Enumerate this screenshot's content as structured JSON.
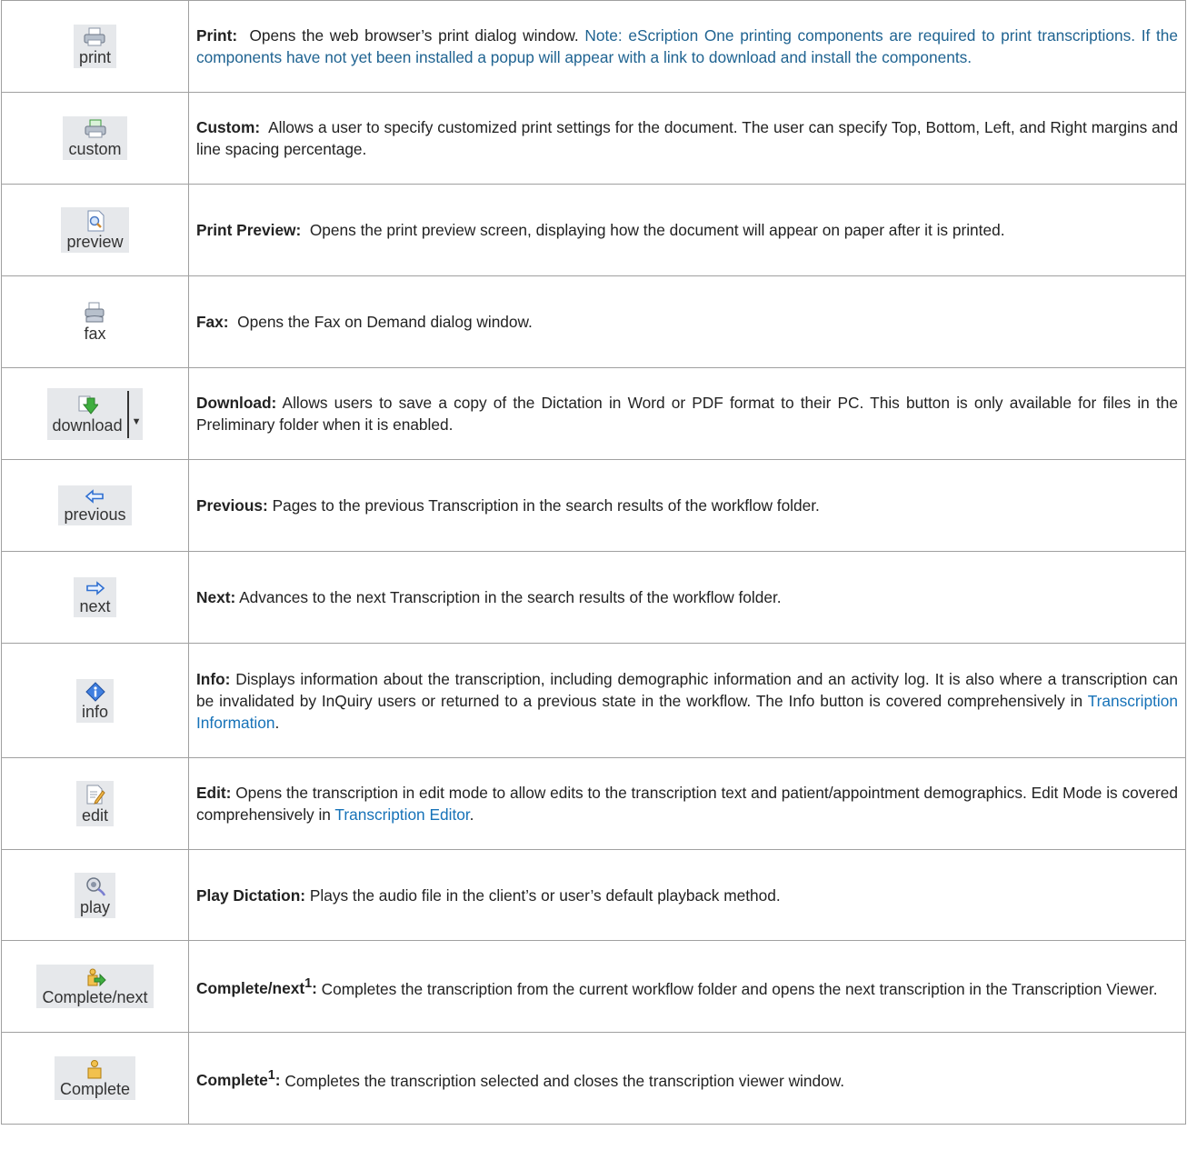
{
  "rows": [
    {
      "icon": "printer-icon",
      "btn": "print",
      "label": "Print:",
      "text": "Opens the web browser’s print dialog window.",
      "note": "Note: eScription One printing components are required to print transcriptions. If the components have not yet been installed a popup will appear with a link to download and install the components."
    },
    {
      "icon": "custom-printer-icon",
      "btn": "custom",
      "label": "Custom:",
      "text": "Allows a user to specify customized print settings for the document. The user can specify Top, Bottom, Left, and Right margins and line spacing percentage."
    },
    {
      "icon": "preview-icon",
      "btn": "preview",
      "label": "Print Preview:",
      "text": "Opens the print preview screen, displaying how the document will appear on paper after it is printed."
    },
    {
      "icon": "fax-icon",
      "btn": "fax",
      "label": "Fax:",
      "text": "Opens the Fax on Demand dialog window."
    },
    {
      "icon": "download-icon",
      "btn": "download",
      "label": "Download:",
      "text": "Allows users to save a copy of the Dictation in Word or PDF format to their PC. This button is only available for files in the Preliminary folder when it is enabled."
    },
    {
      "icon": "arrow-left-icon",
      "btn": "previous",
      "label": "Previous:",
      "text": "Pages to the previous Transcription in the search results of the workflow folder."
    },
    {
      "icon": "arrow-right-icon",
      "btn": "next",
      "label": "Next:",
      "text": "Advances to the next Transcription in the search results of the workflow folder."
    },
    {
      "icon": "info-icon",
      "btn": "info",
      "label": "Info:",
      "text": "Displays information about the transcription, including demographic information and an activity log. It is also where a transcription can be invalidated by InQuiry users or returned to a previous state in the workflow. The Info button is covered comprehensively in",
      "link": "Transcription Information",
      "after": "."
    },
    {
      "icon": "edit-icon",
      "btn": "edit",
      "label": "Edit:",
      "text": "Opens the transcription in edit mode to allow edits to the transcription text and patient/appointment demographics. Edit Mode is covered comprehensively in",
      "link": "Transcription Editor",
      "after": "."
    },
    {
      "icon": "play-icon",
      "btn": "play",
      "label": "Play Dictation:",
      "text": "Plays the audio file in the client’s or user’s default playback method."
    },
    {
      "icon": "complete-next-icon",
      "btn": "Complete/next",
      "label": "Complete/next",
      "sup": "1",
      "colon": ":",
      "text": "Completes the transcription from the current workflow folder and opens the next transcription in the Transcription Viewer."
    },
    {
      "icon": "complete-icon",
      "btn": "Complete",
      "label": "Complete",
      "sup": "1",
      "colon": ":",
      "text": "Completes the transcription selected and closes the transcription viewer window."
    }
  ]
}
